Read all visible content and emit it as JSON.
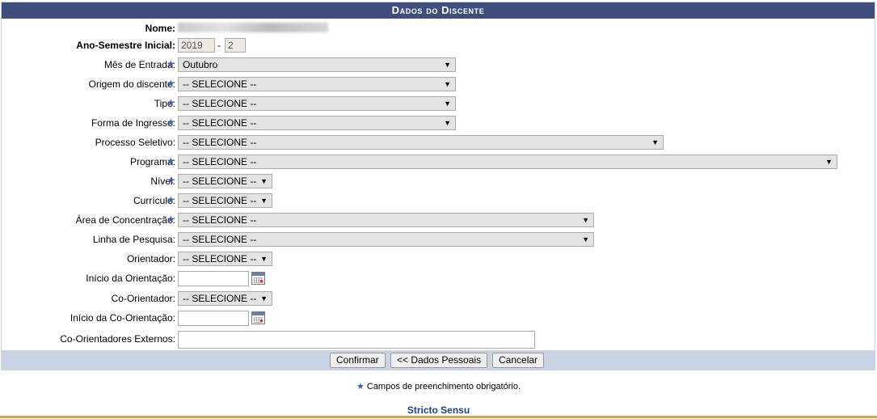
{
  "panel": {
    "title": "Dados do Discente"
  },
  "fields": {
    "nome": {
      "label": "Nome:"
    },
    "ano_semestre": {
      "label": "Ano-Semestre Inicial:",
      "ano": "2019",
      "sep": "-",
      "semestre": "2"
    },
    "mes_entrada": {
      "label": "Mês de Entrada:",
      "value": "Outubro"
    },
    "origem": {
      "label": "Origem do discente:",
      "value": "-- SELECIONE --"
    },
    "tipo": {
      "label": "Tipo:",
      "value": "-- SELECIONE --"
    },
    "forma_ingresso": {
      "label": "Forma de Ingresso:",
      "value": "-- SELECIONE --"
    },
    "processo_seletivo": {
      "label": "Processo Seletivo:",
      "value": "-- SELECIONE --"
    },
    "programa": {
      "label": "Programa:",
      "value": "-- SELECIONE --"
    },
    "nivel": {
      "label": "Nível:",
      "value": "-- SELECIONE --"
    },
    "curriculo": {
      "label": "Currículo:",
      "value": "-- SELECIONE --"
    },
    "area_concentracao": {
      "label": "Área de Concentração:",
      "value": "-- SELECIONE --"
    },
    "linha_pesquisa": {
      "label": "Linha de Pesquisa:",
      "value": "-- SELECIONE --"
    },
    "orientador": {
      "label": "Orientador:",
      "value": "-- SELECIONE --"
    },
    "inicio_orientacao": {
      "label": "Início da Orientação:",
      "value": ""
    },
    "co_orientador": {
      "label": "Co-Orientador:",
      "value": "-- SELECIONE --"
    },
    "inicio_co_orientacao": {
      "label": "Início da Co-Orientação:",
      "value": ""
    },
    "co_orientadores_externos": {
      "label": "Co-Orientadores Externos:",
      "value": ""
    }
  },
  "buttons": {
    "confirmar": "Confirmar",
    "dados_pessoais": "<< Dados Pessoais",
    "cancelar": "Cancelar"
  },
  "note": {
    "required_symbol": "★",
    "text": "Campos de preenchimento obrigatório."
  },
  "footer": {
    "link": "Stricto Sensu"
  },
  "icons": {
    "required": "star-icon",
    "calendar": "calendar-icon",
    "dropdown": "chevron-down-icon"
  },
  "colors": {
    "header": "#3e4f7e",
    "form_footer": "#c8d3e6",
    "required_star": "#3a5fa8",
    "bottom_line": "#c9a85c"
  }
}
